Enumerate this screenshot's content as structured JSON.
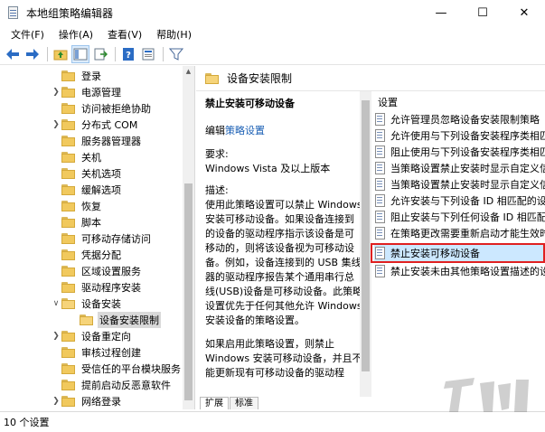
{
  "window": {
    "title": "本地组策略编辑器",
    "minimize": "—",
    "maximize": "☐",
    "close": "✕"
  },
  "menu": [
    "文件(F)",
    "操作(A)",
    "查看(V)",
    "帮助(H)"
  ],
  "toolbar": {
    "icons": [
      "back-arrow-icon",
      "forward-arrow-icon",
      "up-folder-icon",
      "show-hide-tree-icon",
      "export-list-icon",
      "help-icon",
      "properties-icon",
      "filter-icon"
    ]
  },
  "tree": {
    "items": [
      {
        "label": "登录",
        "expandable": false
      },
      {
        "label": "电源管理",
        "expandable": true
      },
      {
        "label": "访问被拒绝协助",
        "expandable": false
      },
      {
        "label": "分布式 COM",
        "expandable": true
      },
      {
        "label": "服务器管理器",
        "expandable": false
      },
      {
        "label": "关机",
        "expandable": false
      },
      {
        "label": "关机选项",
        "expandable": false
      },
      {
        "label": "缓解选项",
        "expandable": false
      },
      {
        "label": "恢复",
        "expandable": false
      },
      {
        "label": "脚本",
        "expandable": false
      },
      {
        "label": "可移动存储访问",
        "expandable": false
      },
      {
        "label": "凭据分配",
        "expandable": false
      },
      {
        "label": "区域设置服务",
        "expandable": false
      },
      {
        "label": "驱动程序安装",
        "expandable": false
      },
      {
        "label": "设备安装",
        "expandable": true,
        "expanded": true
      },
      {
        "label": "设备安装限制",
        "child": true,
        "selected": true
      },
      {
        "label": "设备重定向",
        "expandable": true
      },
      {
        "label": "审核过程创建",
        "expandable": false
      },
      {
        "label": "受信任的平台模块服务",
        "expandable": false
      },
      {
        "label": "提前启动反恶意软件",
        "expandable": false
      },
      {
        "label": "网络登录",
        "expandable": true
      }
    ]
  },
  "detail": {
    "header": "设备安装限制",
    "description": {
      "policy_title": "禁止安装可移动设备",
      "edit_prefix": "编辑",
      "edit_link": "策略设置",
      "requirements_label": "要求:",
      "requirements_value": "Windows Vista 及以上版本",
      "description_label": "描述:",
      "paragraph1": "使用此策略设置可以禁止 Windows 安装可移动设备。如果设备连接到的设备的驱动程序指示该设备是可移动的，则将该设备视为可移动设备。例如，设备连接到的 USB 集线器的驱动程序报告某个通用串行总线(USB)设备是可移动设备。此策略设置优先于任何其他允许 Windows 安装设备的策略设置。",
      "paragraph2": "如果启用此策略设置，则禁止 Windows 安装可移动设备，并且不能更新现有可移动设备的驱动程"
    },
    "settings_header": "设置",
    "settings": [
      "允许管理员忽略设备安装限制策略",
      "允许使用与下列设备安装程序类相匹配",
      "阻止使用与下列设备安装程序类相匹配",
      "当策略设置禁止安装时显示自定义信息",
      "当策略设置禁止安装时显示自定义信息",
      "允许安装与下列设备 ID 相匹配的设备",
      "阻止安装与下列任何设备 ID 相匹配的",
      "在策略更改需要重新启动才能生效时",
      "禁止安装可移动设备",
      "禁止安装未由其他策略设置描述的设备"
    ],
    "selected_setting_index": 8
  },
  "tabs": [
    "扩展",
    "标准"
  ],
  "active_tab": 0,
  "status": "10 个设置"
}
